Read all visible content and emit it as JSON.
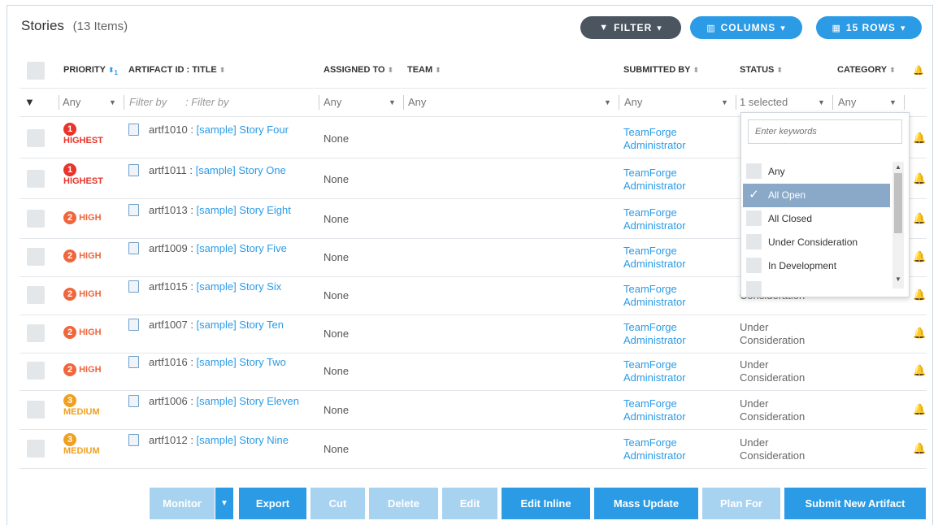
{
  "header": {
    "title": "Stories",
    "count": "(13 Items)",
    "filter_label": "FILTER",
    "columns_label": "COLUMNS",
    "rows_label": "15 ROWS"
  },
  "columns": {
    "priority": "PRIORITY",
    "priority_sort_index": "1",
    "artifact": "ARTIFACT ID : TITLE",
    "assigned": "ASSIGNED TO",
    "team": "TEAM",
    "submitted": "SUBMITTED BY",
    "status": "STATUS",
    "category": "CATEGORY"
  },
  "filters": {
    "priority": "Any",
    "artifact_id": "Filter by",
    "title": ": Filter by",
    "assigned": "Any",
    "team": "Any",
    "submitted": "Any",
    "status": "1 selected",
    "category": "Any"
  },
  "rows": [
    {
      "priority": "HIGHEST",
      "level": "1",
      "id": "artf1010",
      "title": "[sample] Story Four",
      "assigned": "None",
      "submitted": "TeamForge Administrator",
      "status": ""
    },
    {
      "priority": "HIGHEST",
      "level": "1",
      "id": "artf1011",
      "title": "[sample] Story One",
      "assigned": "None",
      "submitted": "TeamForge Administrator",
      "status": ""
    },
    {
      "priority": "HIGH",
      "level": "2",
      "id": "artf1013",
      "title": "[sample] Story Eight",
      "assigned": "None",
      "submitted": "TeamForge Administrator",
      "status": ""
    },
    {
      "priority": "HIGH",
      "level": "2",
      "id": "artf1009",
      "title": "[sample] Story Five",
      "assigned": "None",
      "submitted": "TeamForge Administrator",
      "status": ""
    },
    {
      "priority": "HIGH",
      "level": "2",
      "id": "artf1015",
      "title": "[sample] Story Six",
      "assigned": "None",
      "submitted": "TeamForge Administrator",
      "status": "Consideration"
    },
    {
      "priority": "HIGH",
      "level": "2",
      "id": "artf1007",
      "title": "[sample] Story Ten",
      "assigned": "None",
      "submitted": "TeamForge Administrator",
      "status": "Under Consideration"
    },
    {
      "priority": "HIGH",
      "level": "2",
      "id": "artf1016",
      "title": "[sample] Story Two",
      "assigned": "None",
      "submitted": "TeamForge Administrator",
      "status": "Under Consideration"
    },
    {
      "priority": "MEDIUM",
      "level": "3",
      "id": "artf1006",
      "title": "[sample] Story Eleven",
      "assigned": "None",
      "submitted": "TeamForge Administrator",
      "status": "Under Consideration"
    },
    {
      "priority": "MEDIUM",
      "level": "3",
      "id": "artf1012",
      "title": "[sample] Story Nine",
      "assigned": "None",
      "submitted": "TeamForge Administrator",
      "status": "Under Consideration"
    }
  ],
  "status_dropdown": {
    "placeholder": "Enter keywords",
    "options": [
      "Any",
      "All Open",
      "All Closed",
      "Under Consideration",
      "In Development"
    ],
    "selected": "All Open"
  },
  "actions": {
    "monitor": "Monitor",
    "export": "Export",
    "cut": "Cut",
    "delete": "Delete",
    "edit": "Edit",
    "edit_inline": "Edit Inline",
    "mass_update": "Mass Update",
    "plan_for": "Plan For",
    "submit_new": "Submit New Artifact"
  },
  "colors": {
    "accent": "#2b9be6",
    "highest": "#e8342b",
    "high": "#f0663c",
    "medium": "#f0a020",
    "disabled": "#a8d3f0"
  }
}
